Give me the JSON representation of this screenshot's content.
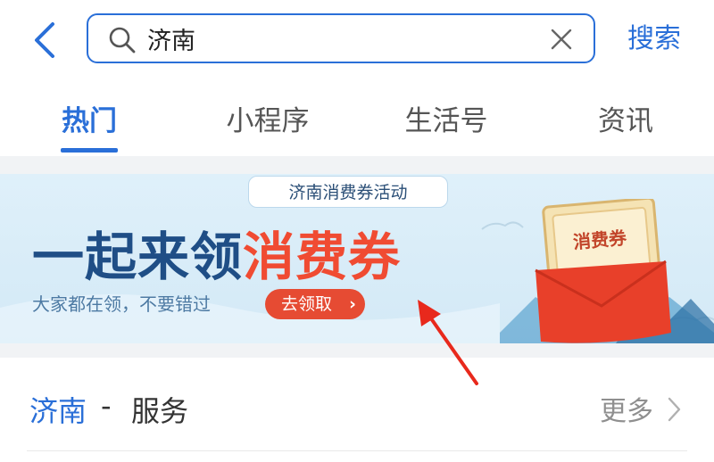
{
  "header": {
    "search": {
      "value": "济南",
      "placeholder": ""
    },
    "search_button": "搜索"
  },
  "tabs": [
    {
      "label": "热门",
      "active": true
    },
    {
      "label": "小程序",
      "active": false
    },
    {
      "label": "生活号",
      "active": false
    },
    {
      "label": "资讯",
      "active": false
    }
  ],
  "banner": {
    "tag": "济南消费券活动",
    "headline_part1": "一起来领",
    "headline_part2": "消费券",
    "subtitle": "大家都在领，不要错过",
    "cta_label": "去领取",
    "cta_chevron": "›",
    "coupon_text": "消费券"
  },
  "services": {
    "city": "济南",
    "separator": "-",
    "label": "服务",
    "more_label": "更多"
  },
  "icons": {
    "back": "chevron-left-icon",
    "search": "search-icon",
    "clear": "close-icon",
    "more": "chevron-right-icon"
  },
  "colors": {
    "accent": "#2a6fd8",
    "headline_blue": "#1f4e86",
    "headline_red": "#f04b32",
    "cta_red": "#e64b33",
    "annotation_red": "#e8291c"
  }
}
